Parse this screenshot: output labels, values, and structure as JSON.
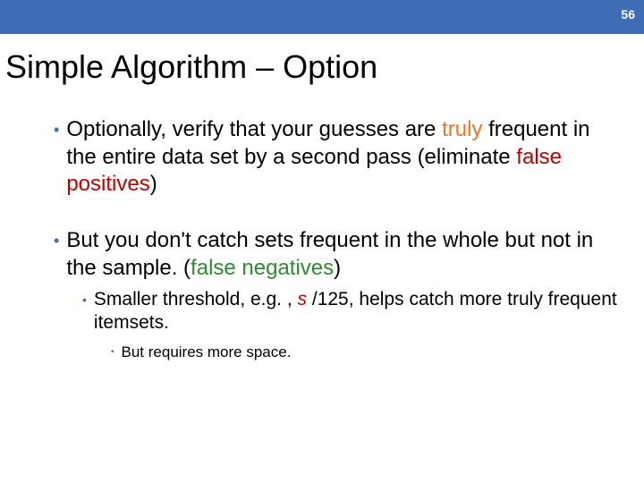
{
  "slide_number": "56",
  "title": "Simple Algorithm – Option",
  "b1": {
    "pre": "Optionally, verify that your guesses are ",
    "truly": "truly",
    "mid": " frequent in the entire data set by a second pass (eliminate ",
    "false_positives": "false positives",
    "close": ")"
  },
  "b2": {
    "pre": "But you don't catch sets frequent in the whole but not in the sample. (",
    "false_negatives": "false negatives",
    "close": ")"
  },
  "sub1": {
    "pre": "Smaller threshold, e.g. , ",
    "s": "s ",
    "mid": "/125, helps catch more truly frequent itemsets."
  },
  "sub2": {
    "text": "But requires more space."
  }
}
